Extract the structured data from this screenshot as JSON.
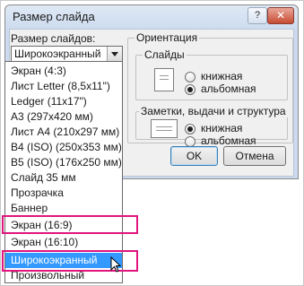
{
  "dialog": {
    "title": "Размер слайда",
    "help_label": "?",
    "close_label": "✕"
  },
  "size": {
    "label": "Размер слайдов:",
    "selected_value": "Широкоэкранный",
    "options": [
      "Экран (4:3)",
      "Лист Letter (8,5x11\")",
      "Ledger (11x17\")",
      "A3 (297x420 мм)",
      "Лист A4 (210x297 мм)",
      "B4 (ISO) (250x353 мм)",
      "B5 (ISO) (176x250 мм)",
      "Слайд 35 мм",
      "Прозрачка",
      "Баннер",
      "Экран (16:9)",
      "Экран (16:10)",
      "Широкоэкранный",
      "Произвольный"
    ],
    "highlighted_option": "Широкоэкранный"
  },
  "orientation": {
    "label": "Ориентация",
    "slides": {
      "label": "Слайды",
      "portrait_label": "книжная",
      "landscape_label": "альбомная",
      "selected": "альбомная"
    },
    "notes": {
      "label": "Заметки, выдачи и структура",
      "portrait_label": "книжная",
      "landscape_label": "альбомная",
      "selected": "книжная"
    }
  },
  "buttons": {
    "ok": "OK",
    "cancel": "Отмена"
  },
  "colors": {
    "selection": "#3399ff",
    "callout_highlight": "#e0157d"
  }
}
